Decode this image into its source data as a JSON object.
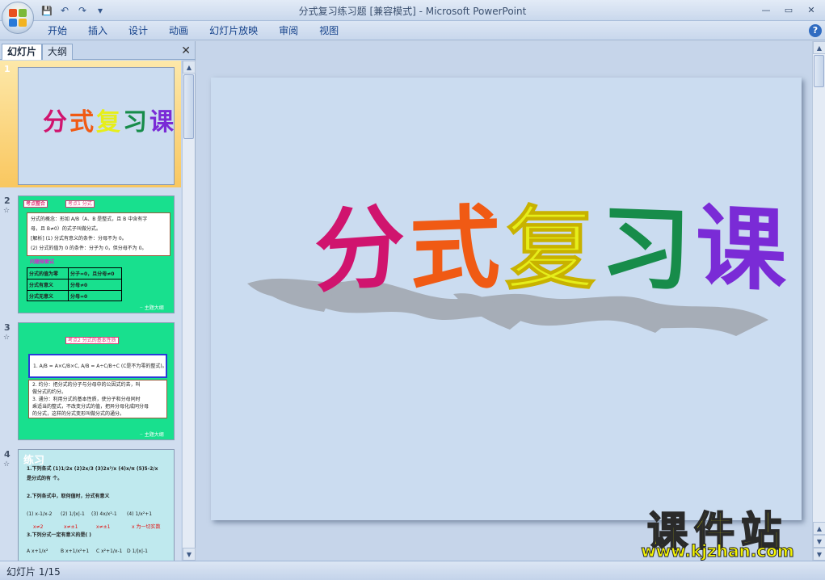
{
  "window": {
    "title": "分式复习练习题 [兼容模式] - Microsoft PowerPoint"
  },
  "quick_access": {
    "icons": [
      "save-icon",
      "undo-icon",
      "redo-icon",
      "customize-icon"
    ],
    "save": "💾",
    "undo": "↶",
    "redo": "↷",
    "customize": "▾"
  },
  "window_controls": {
    "minimize": "—",
    "restore": "▭",
    "close": "✕"
  },
  "ribbon": {
    "tabs": [
      "开始",
      "插入",
      "设计",
      "动画",
      "幻灯片放映",
      "审阅",
      "视图"
    ],
    "help": "?"
  },
  "left_pane": {
    "tab_slides": "幻灯片",
    "tab_outline": "大纲",
    "close": "✕"
  },
  "thumbnails": [
    {
      "number": "1",
      "star": ""
    },
    {
      "number": "2",
      "star": "☆"
    },
    {
      "number": "3",
      "star": "☆"
    },
    {
      "number": "4",
      "star": "☆"
    }
  ],
  "slide1": {
    "title_chars": [
      "分",
      "式",
      "复",
      "习",
      "课"
    ],
    "char_colors": [
      "#d0146e",
      "#f05a14",
      "#e6ee1a",
      "#178c4a",
      "#7a2bd6"
    ]
  },
  "slide2": {
    "tag1": "考点整合",
    "tag2": "考点1 分式",
    "lines": [
      "分式的概念：形如 A/B（A、B 是整式，且 B 中含有字",
      "母，且 B≠0）的式子叫做分式。",
      "[解析] (1) 分式有意义的条件：分母不为 0。",
      "(2) 分式的值为 0 的条件：分子为 0，但分母不为 0。"
    ],
    "table_title": "问题探索试",
    "table_rows": [
      [
        "分式的值为零",
        "分子=0，且分母≠0"
      ],
      [
        "分式有意义",
        "分母≠0"
      ],
      [
        "分式无意义",
        "分母=0"
      ]
    ],
    "footer": "·· 主题大纲"
  },
  "slide3": {
    "tag": "考点2 分式的基本性质",
    "formula": "1. A/B = A×C/B×C, A/B = A÷C/B÷C (C是不为零的整式)。",
    "lines": [
      "2. 约分：把分式的分子与分母中的公因式约去，叫",
      "做分式的约分。",
      "3. 通分：利用分式的基本性质，使分子和分母同时",
      "乘适当的整式，不改变分式的值，把异分母化成同分母",
      "的分式，这样的分式变形叫做分式的通分。"
    ],
    "footer": "·· 主题大纲"
  },
  "slide4": {
    "heading": "练习",
    "q1": "1.下列各式 (1)1/2x (2)2x/3 (3)2x²/x (4)x/π (5)5-2/x",
    "q1b": "是分式的有 个。",
    "q2": "2.下列各式中，取何值时，分式有意义",
    "q2_items": [
      "(1) x-1/x-2",
      "(2) 1/|x|-1",
      "(3) 4x/x²-1",
      "(4) 1/x²+1"
    ],
    "q2_answers": [
      "x≠2",
      "x≠±1",
      "x≠±1",
      "x 为一切实数"
    ],
    "q3": "3.下列分式一定有意义的是( )",
    "q3_items": [
      "A x+1/x²",
      "B x+1/x²+1",
      "C x²+1/x-1",
      "D 1/|x|-1"
    ]
  },
  "status": {
    "slide_indicator": "幻灯片 1/15"
  },
  "watermark": {
    "title": "课件站",
    "url": "www.kjzhan.com"
  }
}
